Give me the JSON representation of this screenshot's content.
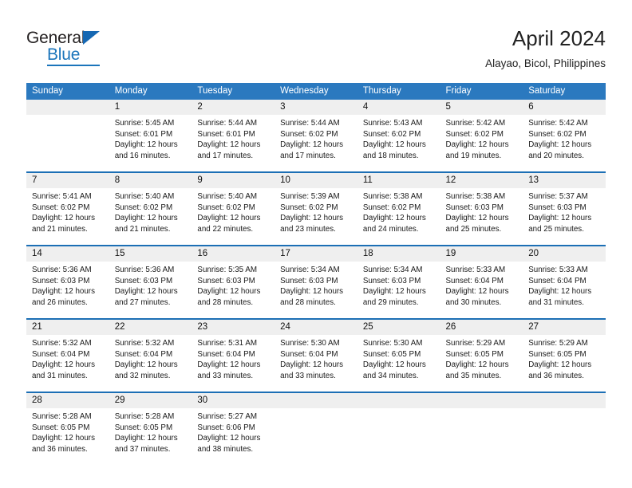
{
  "branding": {
    "logo_primary": "General",
    "logo_secondary": "Blue",
    "logo_triangle_color": "#1668b3",
    "logo_blue_color": "#1b75bb"
  },
  "header": {
    "month_title": "April 2024",
    "location": "Alayao, Bicol, Philippines"
  },
  "theme": {
    "header_blue": "#2b79bf",
    "row_divider_blue": "#1c6fb5",
    "daynum_band": "#efefef"
  },
  "weekdays": [
    "Sunday",
    "Monday",
    "Tuesday",
    "Wednesday",
    "Thursday",
    "Friday",
    "Saturday"
  ],
  "weeks": [
    [
      {
        "day": "",
        "lines": []
      },
      {
        "day": "1",
        "lines": [
          "Sunrise: 5:45 AM",
          "Sunset: 6:01 PM",
          "Daylight: 12 hours",
          "and 16 minutes."
        ]
      },
      {
        "day": "2",
        "lines": [
          "Sunrise: 5:44 AM",
          "Sunset: 6:01 PM",
          "Daylight: 12 hours",
          "and 17 minutes."
        ]
      },
      {
        "day": "3",
        "lines": [
          "Sunrise: 5:44 AM",
          "Sunset: 6:02 PM",
          "Daylight: 12 hours",
          "and 17 minutes."
        ]
      },
      {
        "day": "4",
        "lines": [
          "Sunrise: 5:43 AM",
          "Sunset: 6:02 PM",
          "Daylight: 12 hours",
          "and 18 minutes."
        ]
      },
      {
        "day": "5",
        "lines": [
          "Sunrise: 5:42 AM",
          "Sunset: 6:02 PM",
          "Daylight: 12 hours",
          "and 19 minutes."
        ]
      },
      {
        "day": "6",
        "lines": [
          "Sunrise: 5:42 AM",
          "Sunset: 6:02 PM",
          "Daylight: 12 hours",
          "and 20 minutes."
        ]
      }
    ],
    [
      {
        "day": "7",
        "lines": [
          "Sunrise: 5:41 AM",
          "Sunset: 6:02 PM",
          "Daylight: 12 hours",
          "and 21 minutes."
        ]
      },
      {
        "day": "8",
        "lines": [
          "Sunrise: 5:40 AM",
          "Sunset: 6:02 PM",
          "Daylight: 12 hours",
          "and 21 minutes."
        ]
      },
      {
        "day": "9",
        "lines": [
          "Sunrise: 5:40 AM",
          "Sunset: 6:02 PM",
          "Daylight: 12 hours",
          "and 22 minutes."
        ]
      },
      {
        "day": "10",
        "lines": [
          "Sunrise: 5:39 AM",
          "Sunset: 6:02 PM",
          "Daylight: 12 hours",
          "and 23 minutes."
        ]
      },
      {
        "day": "11",
        "lines": [
          "Sunrise: 5:38 AM",
          "Sunset: 6:02 PM",
          "Daylight: 12 hours",
          "and 24 minutes."
        ]
      },
      {
        "day": "12",
        "lines": [
          "Sunrise: 5:38 AM",
          "Sunset: 6:03 PM",
          "Daylight: 12 hours",
          "and 25 minutes."
        ]
      },
      {
        "day": "13",
        "lines": [
          "Sunrise: 5:37 AM",
          "Sunset: 6:03 PM",
          "Daylight: 12 hours",
          "and 25 minutes."
        ]
      }
    ],
    [
      {
        "day": "14",
        "lines": [
          "Sunrise: 5:36 AM",
          "Sunset: 6:03 PM",
          "Daylight: 12 hours",
          "and 26 minutes."
        ]
      },
      {
        "day": "15",
        "lines": [
          "Sunrise: 5:36 AM",
          "Sunset: 6:03 PM",
          "Daylight: 12 hours",
          "and 27 minutes."
        ]
      },
      {
        "day": "16",
        "lines": [
          "Sunrise: 5:35 AM",
          "Sunset: 6:03 PM",
          "Daylight: 12 hours",
          "and 28 minutes."
        ]
      },
      {
        "day": "17",
        "lines": [
          "Sunrise: 5:34 AM",
          "Sunset: 6:03 PM",
          "Daylight: 12 hours",
          "and 28 minutes."
        ]
      },
      {
        "day": "18",
        "lines": [
          "Sunrise: 5:34 AM",
          "Sunset: 6:03 PM",
          "Daylight: 12 hours",
          "and 29 minutes."
        ]
      },
      {
        "day": "19",
        "lines": [
          "Sunrise: 5:33 AM",
          "Sunset: 6:04 PM",
          "Daylight: 12 hours",
          "and 30 minutes."
        ]
      },
      {
        "day": "20",
        "lines": [
          "Sunrise: 5:33 AM",
          "Sunset: 6:04 PM",
          "Daylight: 12 hours",
          "and 31 minutes."
        ]
      }
    ],
    [
      {
        "day": "21",
        "lines": [
          "Sunrise: 5:32 AM",
          "Sunset: 6:04 PM",
          "Daylight: 12 hours",
          "and 31 minutes."
        ]
      },
      {
        "day": "22",
        "lines": [
          "Sunrise: 5:32 AM",
          "Sunset: 6:04 PM",
          "Daylight: 12 hours",
          "and 32 minutes."
        ]
      },
      {
        "day": "23",
        "lines": [
          "Sunrise: 5:31 AM",
          "Sunset: 6:04 PM",
          "Daylight: 12 hours",
          "and 33 minutes."
        ]
      },
      {
        "day": "24",
        "lines": [
          "Sunrise: 5:30 AM",
          "Sunset: 6:04 PM",
          "Daylight: 12 hours",
          "and 33 minutes."
        ]
      },
      {
        "day": "25",
        "lines": [
          "Sunrise: 5:30 AM",
          "Sunset: 6:05 PM",
          "Daylight: 12 hours",
          "and 34 minutes."
        ]
      },
      {
        "day": "26",
        "lines": [
          "Sunrise: 5:29 AM",
          "Sunset: 6:05 PM",
          "Daylight: 12 hours",
          "and 35 minutes."
        ]
      },
      {
        "day": "27",
        "lines": [
          "Sunrise: 5:29 AM",
          "Sunset: 6:05 PM",
          "Daylight: 12 hours",
          "and 36 minutes."
        ]
      }
    ],
    [
      {
        "day": "28",
        "lines": [
          "Sunrise: 5:28 AM",
          "Sunset: 6:05 PM",
          "Daylight: 12 hours",
          "and 36 minutes."
        ]
      },
      {
        "day": "29",
        "lines": [
          "Sunrise: 5:28 AM",
          "Sunset: 6:05 PM",
          "Daylight: 12 hours",
          "and 37 minutes."
        ]
      },
      {
        "day": "30",
        "lines": [
          "Sunrise: 5:27 AM",
          "Sunset: 6:06 PM",
          "Daylight: 12 hours",
          "and 38 minutes."
        ]
      },
      {
        "day": "",
        "lines": []
      },
      {
        "day": "",
        "lines": []
      },
      {
        "day": "",
        "lines": []
      },
      {
        "day": "",
        "lines": []
      }
    ]
  ]
}
